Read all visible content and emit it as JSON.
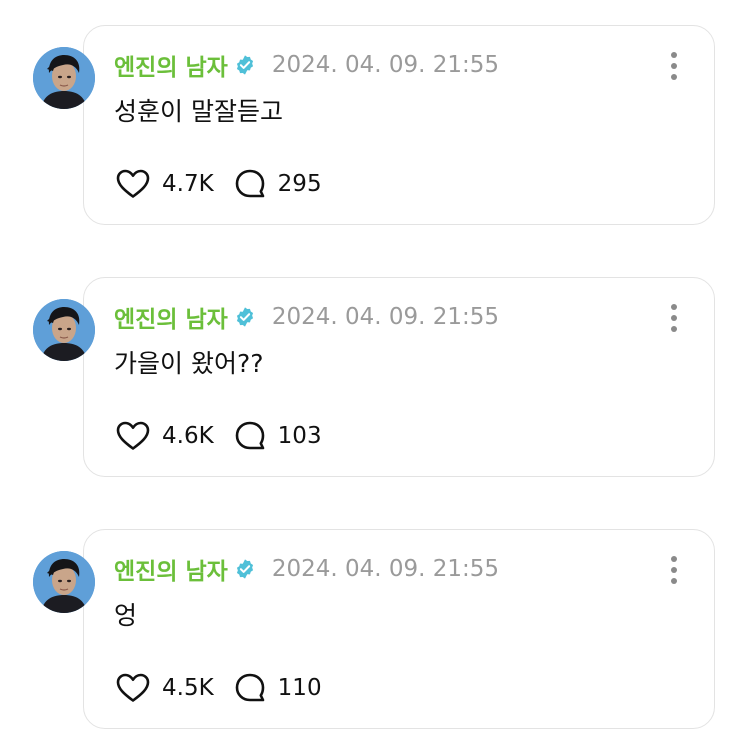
{
  "posts": [
    {
      "author": "엔진의 남자",
      "timestamp": "2024. 04. 09. 21:55",
      "text": "성훈이 말잘듣고",
      "likes": "4.7K",
      "replies": "295"
    },
    {
      "author": "엔진의 남자",
      "timestamp": "2024. 04. 09. 21:55",
      "text": "가을이 왔어??",
      "likes": "4.6K",
      "replies": "103"
    },
    {
      "author": "엔진의 남자",
      "timestamp": "2024. 04. 09. 21:55",
      "text": "엉",
      "likes": "4.5K",
      "replies": "110"
    }
  ],
  "colors": {
    "author": "#6bbf3a",
    "verified_badge": "#4fc0d8",
    "timestamp": "#9a9a9a",
    "card_border": "#e3e3e3"
  },
  "icons": {
    "verified": "verified-badge-icon",
    "menu": "more-vertical-icon",
    "like": "heart-icon",
    "reply": "speech-bubble-icon"
  }
}
